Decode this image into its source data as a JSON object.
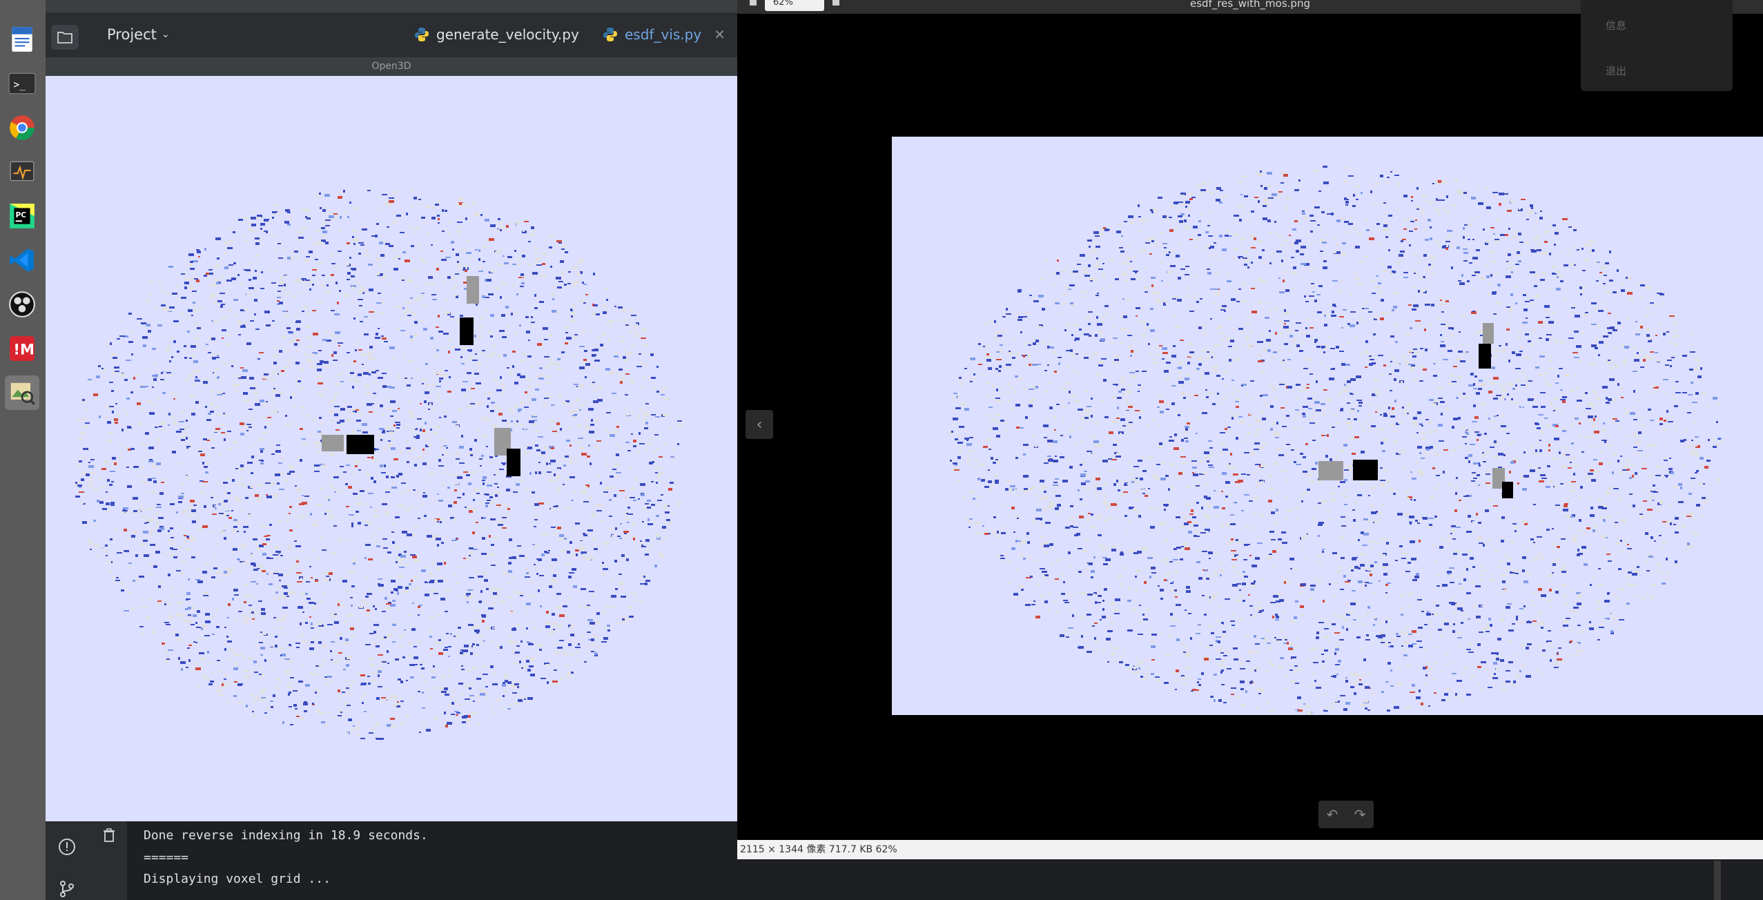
{
  "ide": {
    "project_label": "Project",
    "tabs": [
      {
        "label": "generate_velocity.py"
      },
      {
        "label": "esdf_vis.py"
      }
    ],
    "open3d_title": "Open3D",
    "console_lines": [
      "Done reverse indexing in 18.9 seconds.",
      "======",
      "Displaying voxel grid ..."
    ]
  },
  "viewer": {
    "title": "esdf_res_with_mos.png",
    "zoom_value": "62%",
    "status_text": "2115 × 1344 像素  717.7 KB   62%",
    "menu_items": [
      "信息",
      "退出"
    ]
  },
  "dock": {
    "apps": [
      "document-icon",
      "terminal-icon",
      "chrome-icon",
      "system-monitor-icon",
      "pycharm-icon",
      "vscode-icon",
      "obs-icon",
      "mendeley-icon",
      "image-viewer-icon"
    ]
  },
  "colors": {
    "canvas_bg": "#dcdfff",
    "voxel_blue": "#3a4cc0",
    "voxel_red": "#d1493e",
    "voxel_grey": "#e0e0e0"
  }
}
